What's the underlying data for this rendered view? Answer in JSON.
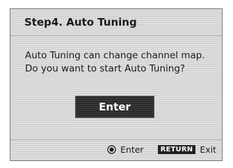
{
  "dialog": {
    "title": "Step4. Auto Tuning",
    "message_line1": "Auto Tuning can change channel map.",
    "message_line2": "Do you want to start Auto Tuning?",
    "button_label": "Enter"
  },
  "footer": {
    "ok_icon": "ok-button-icon",
    "enter_label": "Enter",
    "return_key": "RETURN",
    "exit_label": "Exit"
  }
}
